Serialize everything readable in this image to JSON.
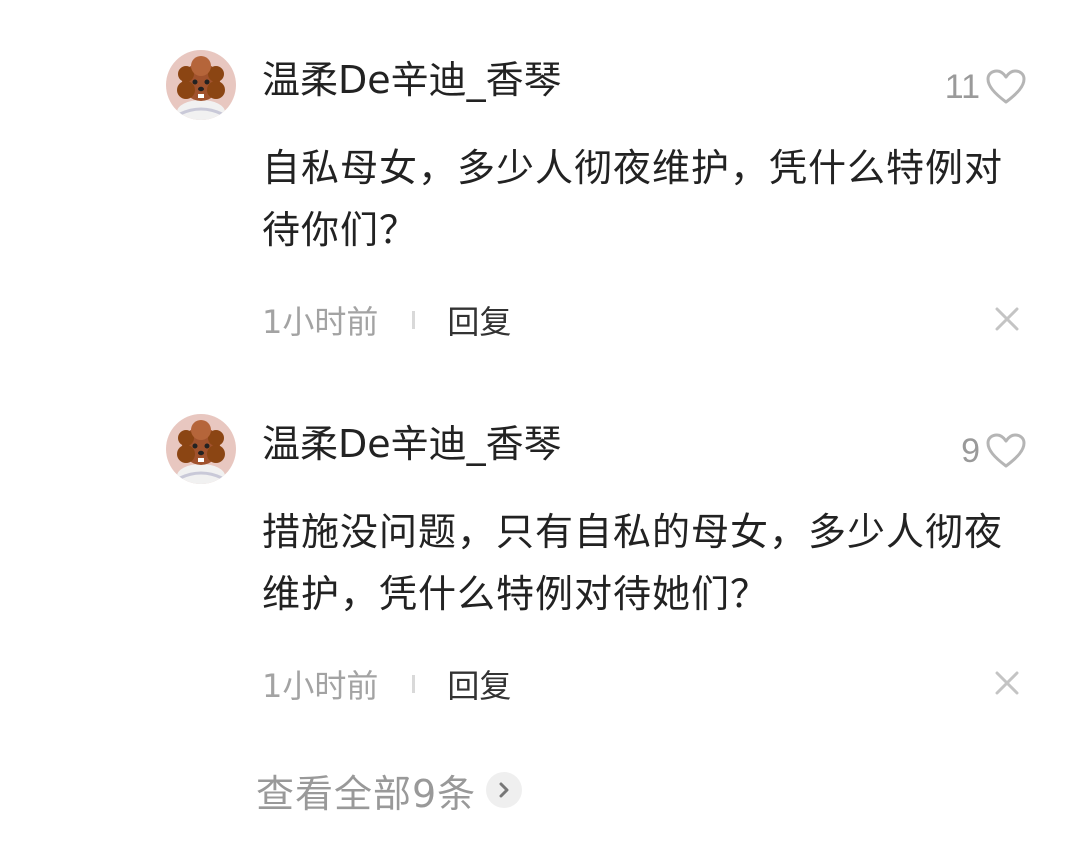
{
  "comments": [
    {
      "username": "温柔De辛迪_香琴",
      "likes": "11",
      "content": "自私母女，多少人彻夜维护，凭什么特例对待你们？",
      "time": "1小时前",
      "reply_label": "回复",
      "avatar_icon": "poodle-avatar-icon"
    },
    {
      "username": "温柔De辛迪_香琴",
      "likes": "9",
      "content": "措施没问题，只有自私的母女，多少人彻夜维护，凭什么特例对待她们？",
      "time": "1小时前",
      "reply_label": "回复",
      "avatar_icon": "poodle-avatar-icon"
    }
  ],
  "view_all": {
    "label": "查看全部9条",
    "icon": "chevron-right-icon"
  },
  "colors": {
    "text_primary": "#222222",
    "text_secondary": "#9a9a9a",
    "icon_gray": "#bbbbbb"
  }
}
